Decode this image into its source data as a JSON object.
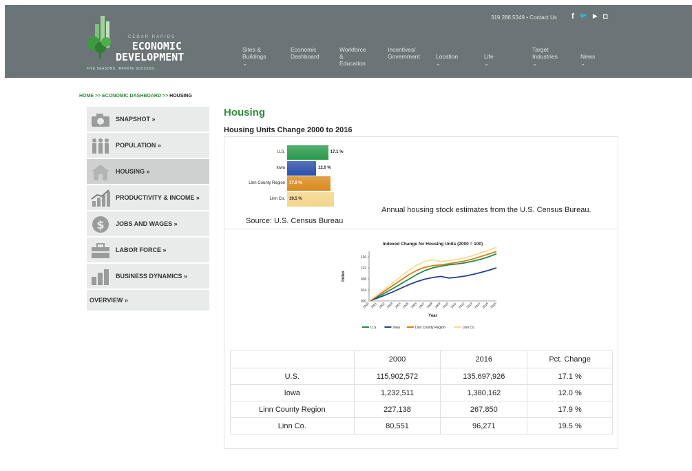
{
  "header": {
    "logo": {
      "small": "CEDAR RAPIDS",
      "line1": "ECONOMIC",
      "line2": "DEVELOPMENT",
      "tagline": "FIVE SEASONS. INFINITE SUCCESS."
    },
    "contact": "319.286.5349 • Contact Us",
    "social_icons": [
      "facebook-icon",
      "twitter-icon",
      "youtube-icon",
      "instagram-icon"
    ],
    "social_glyphs": [
      "f",
      "🐦",
      "▶",
      "◘"
    ],
    "nav": [
      {
        "label": "Sites &\nBuildings ⌄"
      },
      {
        "label": "Economic\nDashboard"
      },
      {
        "label": "Workforce &\nEducation"
      },
      {
        "label": "Incentives/\nGovernment"
      },
      {
        "label": "Location ⌄"
      },
      {
        "label": "Life ⌄"
      },
      {
        "label": "Target\nIndustries ⌄"
      },
      {
        "label": "News ⌄"
      }
    ]
  },
  "breadcrumb": {
    "home": "HOME",
    "sep1": ">>",
    "dashboard": "ECONOMIC DASHBOARD",
    "sep2": ">>",
    "current": "HOUSING"
  },
  "sidebar": {
    "items": [
      {
        "label": "SNAPSHOT »",
        "icon": "camera-icon"
      },
      {
        "label": "POPULATION »",
        "icon": "people-icon"
      },
      {
        "label": "HOUSING »",
        "icon": "house-icon"
      },
      {
        "label": "PRODUCTIVITY & INCOME »",
        "icon": "growth-chart-icon"
      },
      {
        "label": "JOBS AND WAGES »",
        "icon": "dollar-icon"
      },
      {
        "label": "LABOR FORCE »",
        "icon": "briefcase-icon"
      },
      {
        "label": "BUSINESS DYNAMICS »",
        "icon": "bar-chart-icon"
      },
      {
        "label": "OVERVIEW »"
      }
    ]
  },
  "main": {
    "title": "Housing",
    "section_title": "Housing Units Change 2000 to 2016",
    "source": "Source: U.S. Census Bureau",
    "caption": "Annual housing stock estimates from the U.S. Census Bureau.",
    "table": {
      "headers": [
        "",
        "2000",
        "2016",
        "Pct. Change"
      ],
      "rows": [
        [
          "U.S.",
          "115,902,572",
          "135,697,926",
          "17.1 %"
        ],
        [
          "Iowa",
          "1,232,511",
          "1,380,162",
          "12.0 %"
        ],
        [
          "Linn County Region",
          "227,138",
          "267,850",
          "17.9 %"
        ],
        [
          "Linn Co.",
          "80,551",
          "96,271",
          "19.5 %"
        ]
      ]
    }
  },
  "chart_data": [
    {
      "type": "bar",
      "orientation": "horizontal",
      "categories": [
        "U.S.",
        "Iowa",
        "Linn County Region",
        "Linn Co."
      ],
      "values": [
        17.1,
        12.0,
        17.9,
        19.5
      ],
      "value_labels": [
        "17.1 %",
        "12.0 %",
        "17.9 %",
        "19.5 %"
      ],
      "colors": [
        "#2a9a4a",
        "#2b4fa8",
        "#d98a1c",
        "#f3d58a"
      ],
      "label_colors": [
        "#222222",
        "#222222",
        "#ffffff",
        "#222222"
      ]
    },
    {
      "type": "line",
      "title": "Indexed Change for Housing Units (2000 = 100)",
      "xlabel": "Year",
      "ylabel": "Index",
      "x": [
        "2000",
        "2001",
        "2002",
        "2003",
        "2004",
        "2005",
        "2006",
        "2007",
        "2008",
        "2009",
        "2010",
        "2011",
        "2012",
        "2013",
        "2014",
        "2015",
        "2016"
      ],
      "ylim": [
        100,
        118
      ],
      "yticks": [
        100,
        104,
        108,
        112,
        116
      ],
      "legend": "bottom",
      "series": [
        {
          "name": "U.S.",
          "color": "#1f8a44",
          "values": [
            100,
            101.4,
            102.9,
            104.5,
            106.2,
            107.9,
            109.6,
            111.0,
            112.0,
            112.6,
            113.1,
            113.4,
            113.8,
            114.4,
            115.1,
            116.0,
            117.1
          ]
        },
        {
          "name": "Iowa",
          "color": "#253f8f",
          "values": [
            100,
            101.0,
            102.1,
            103.3,
            104.6,
            105.9,
            107.0,
            107.9,
            108.5,
            108.9,
            108.3,
            108.6,
            109.0,
            109.6,
            110.3,
            111.1,
            112.0
          ]
        },
        {
          "name": "Linn County Region",
          "color": "#d97a12",
          "values": [
            100,
            101.8,
            103.7,
            105.6,
            107.6,
            109.5,
            111.1,
            112.2,
            112.8,
            113.1,
            113.5,
            114.0,
            114.5,
            115.2,
            116.1,
            117.0,
            117.9
          ]
        },
        {
          "name": "Linn Co.",
          "color": "#f6dc94",
          "values": [
            100,
            102.1,
            104.3,
            106.6,
            108.9,
            111.1,
            113.0,
            114.3,
            114.9,
            114.3,
            114.6,
            115.0,
            115.6,
            116.4,
            117.4,
            118.4,
            119.5
          ]
        }
      ]
    }
  ]
}
